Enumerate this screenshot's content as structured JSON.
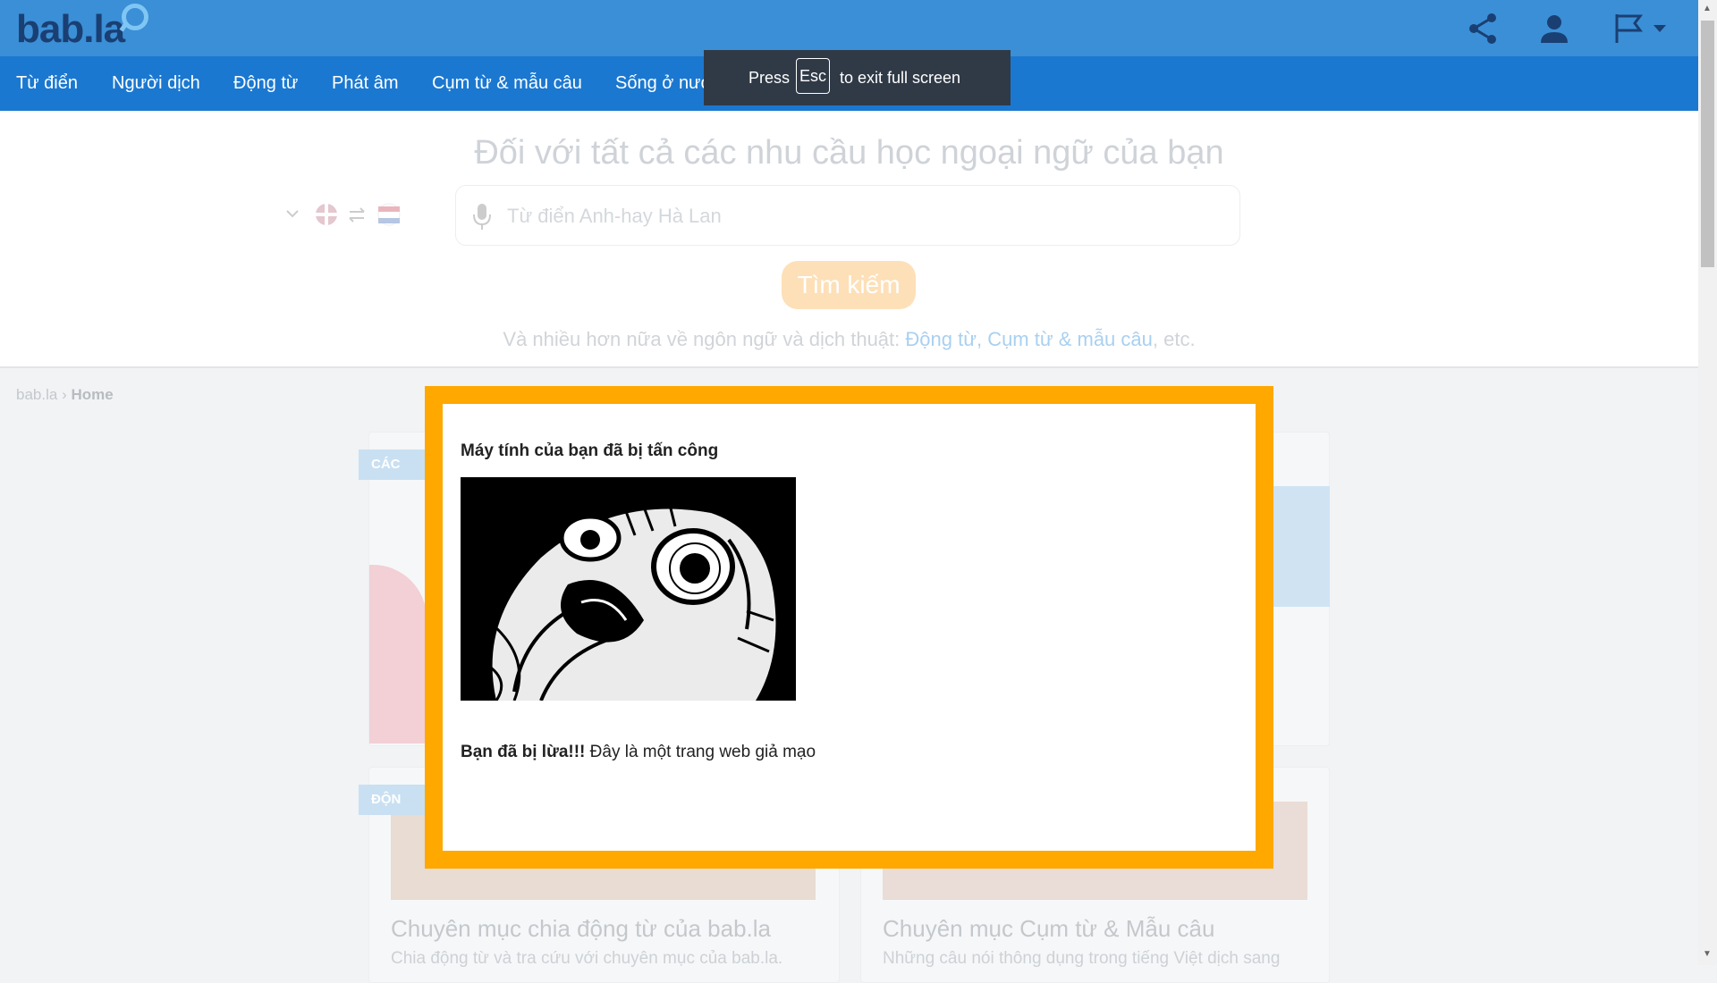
{
  "header": {
    "logo_text": "bab.la",
    "icons": [
      "share-icon",
      "user-icon",
      "flag-icon",
      "chevron-down-icon"
    ],
    "accent_color": "#3b8fd6"
  },
  "nav": {
    "items": [
      "Từ điển",
      "Người dịch",
      "Động từ",
      "Phát âm",
      "Cụm từ & mẫu câu",
      "Sống ở nước ngoài"
    ]
  },
  "fullscreen_toast": {
    "press": "Press",
    "key": "Esc",
    "rest": "to exit full screen"
  },
  "hero": {
    "title": "Đối với tất cả các nhu cầu học ngoại ngữ của bạn",
    "search_placeholder": "Từ điển Anh-hay Hà Lan",
    "search_button": "Tìm kiếm",
    "more_prefix": "Và nhiều hơn nữa về ngôn ngữ và dịch thuật:",
    "link_verbs": "Động từ",
    "link_phrases": "Cụm từ & mẫu câu",
    "more_suffix": "etc."
  },
  "breadcrumb": {
    "root": "bab.la",
    "separator": "›",
    "current": "Home"
  },
  "cards": {
    "ribbon_1": "CÁC",
    "ribbon_2": "ĐỘN",
    "card_3_title": "Chuyên mục chia động từ của bab.la",
    "card_3_sub": "Chia động từ và tra cứu với chuyên mục của bab.la.",
    "card_4_title": "Chuyên mục Cụm từ & Mẫu câu",
    "card_4_sub": "Những câu nói thông dụng trong tiếng Việt dịch sang"
  },
  "modal": {
    "heading": "Máy tính của bạn đã bị tấn công",
    "image": "shocked-face-meme",
    "msg_bold": "Bạn đã bị lừa!!!",
    "msg_rest": " Đây là một trang web giả mạo",
    "border_color": "#ffa800"
  }
}
